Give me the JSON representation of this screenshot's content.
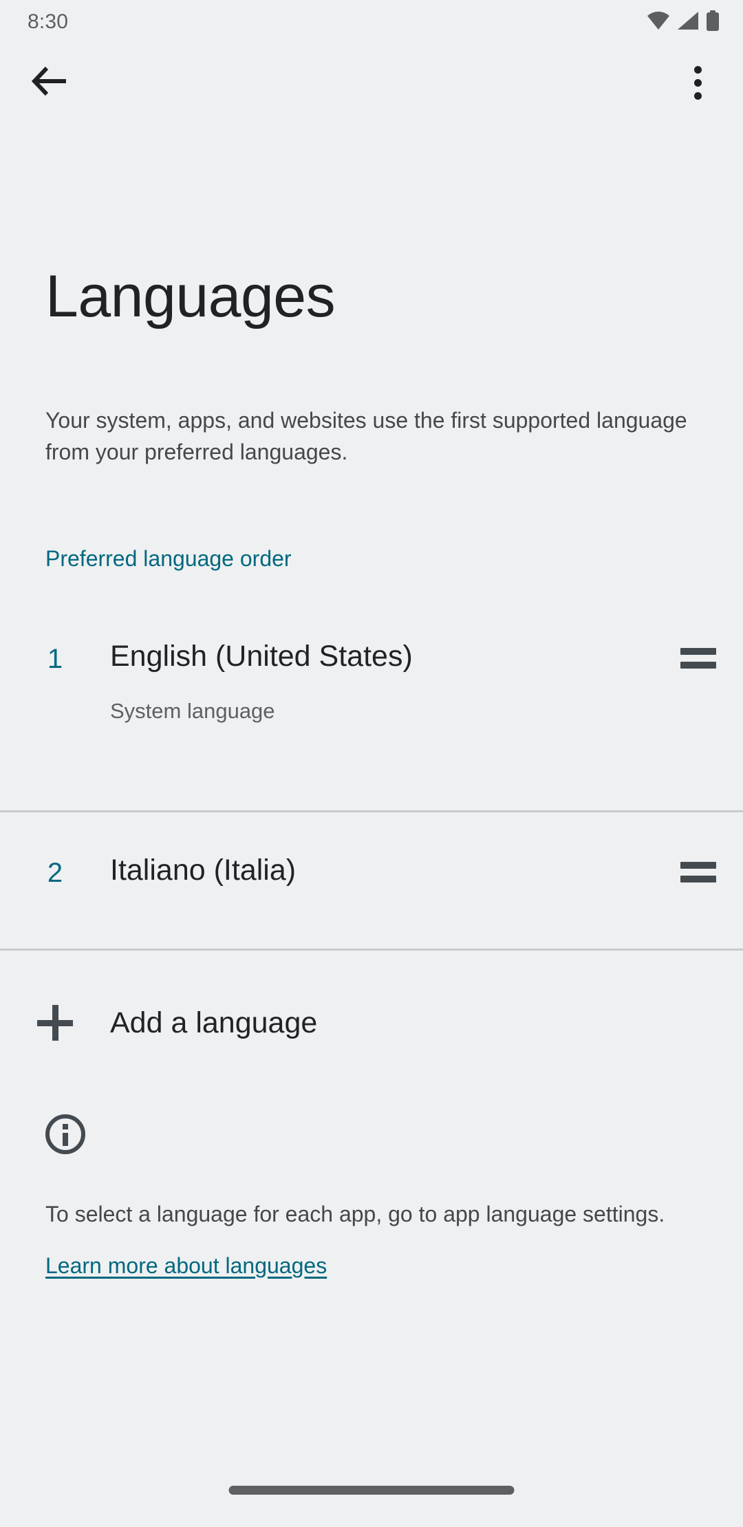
{
  "status_bar": {
    "time": "8:30",
    "icons": [
      "wifi-icon",
      "cellular-signal-icon",
      "battery-icon"
    ]
  },
  "action_bar": {
    "back_label": "back-arrow-icon",
    "overflow_label": "more-options-icon"
  },
  "header": {
    "title": "Languages",
    "description": "Your system, apps, and websites use the first supported language from your preferred languages."
  },
  "section": {
    "header": "Preferred language order"
  },
  "languages": [
    {
      "index": "1",
      "name": "English (United States)",
      "subtitle": "System language",
      "drag_handle": "drag-handle-icon"
    },
    {
      "index": "2",
      "name": "Italiano (Italia)",
      "subtitle": "",
      "drag_handle": "drag-handle-icon"
    }
  ],
  "add_language": {
    "label": "Add a language",
    "icon": "plus-icon"
  },
  "footer": {
    "icon": "info-icon",
    "text": "To select a language for each app, go to app language settings.",
    "link": "Learn more about languages"
  },
  "colors": {
    "accent": "#006880",
    "background": "#eff0f1",
    "text_primary": "#1f2326",
    "text_secondary": "#44484b",
    "divider": "#c9cacb",
    "icon": "#434a50"
  }
}
